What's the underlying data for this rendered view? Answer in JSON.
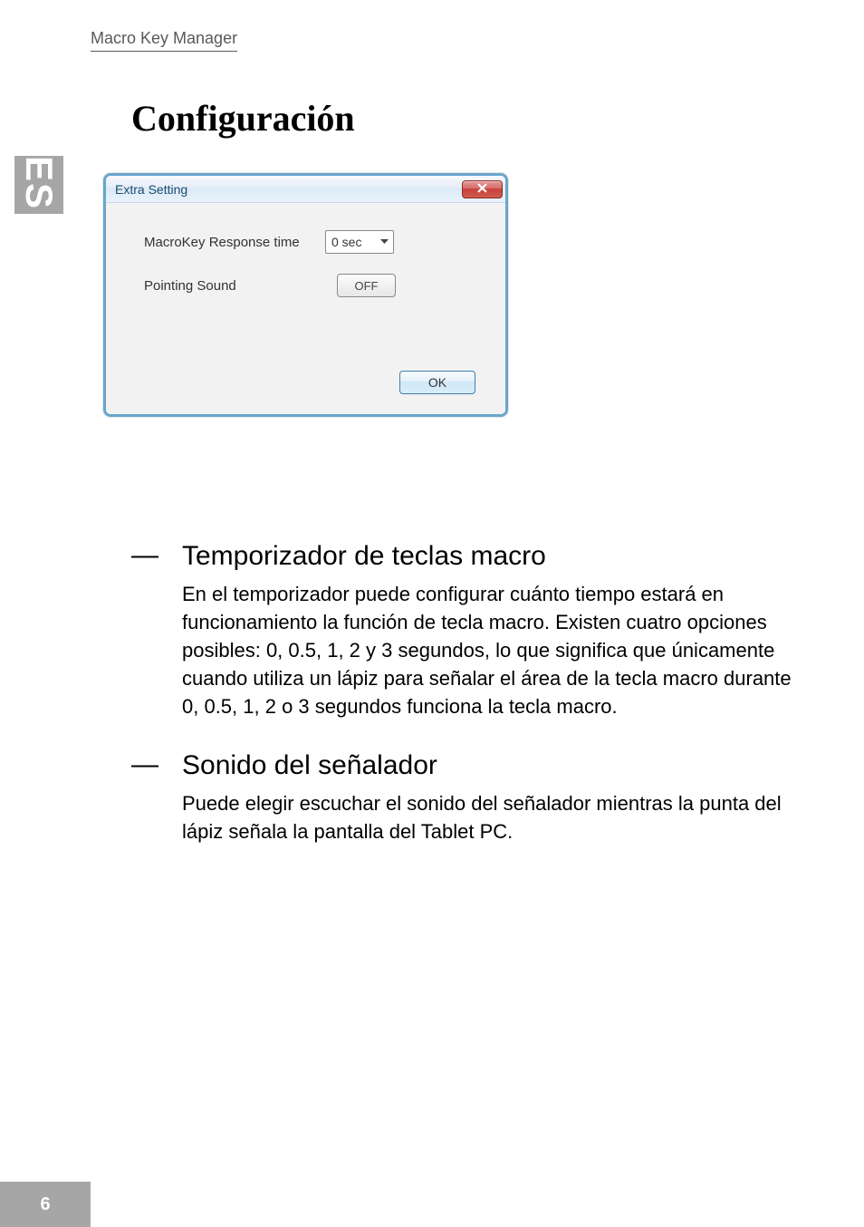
{
  "header": {
    "running_title": "Macro Key Manager"
  },
  "language_tab": "ES",
  "heading": "Configuración",
  "dialog": {
    "title": "Extra Setting",
    "rows": {
      "response": {
        "label": "MacroKey Response time",
        "value": "0 sec"
      },
      "sound": {
        "label": "Pointing Sound",
        "value": "OFF"
      }
    },
    "ok": "OK"
  },
  "sections": {
    "timer": {
      "title": "Temporizador de teclas macro",
      "body": "En el temporizador puede configurar cuánto tiempo estará en funcionamiento la función de tecla macro. Existen cuatro opciones posibles: 0, 0.5, 1, 2 y 3 segundos, lo que significa que únicamente cuando utiliza un lápiz para señalar el área de la tecla macro durante 0, 0.5, 1, 2 o 3 segundos funciona la tecla macro."
    },
    "sound": {
      "title": "Sonido del señalador",
      "body": "Puede elegir escuchar el sonido del señalador mientras la punta del lápiz señala la pantalla del Tablet PC."
    }
  },
  "page_number": "6"
}
